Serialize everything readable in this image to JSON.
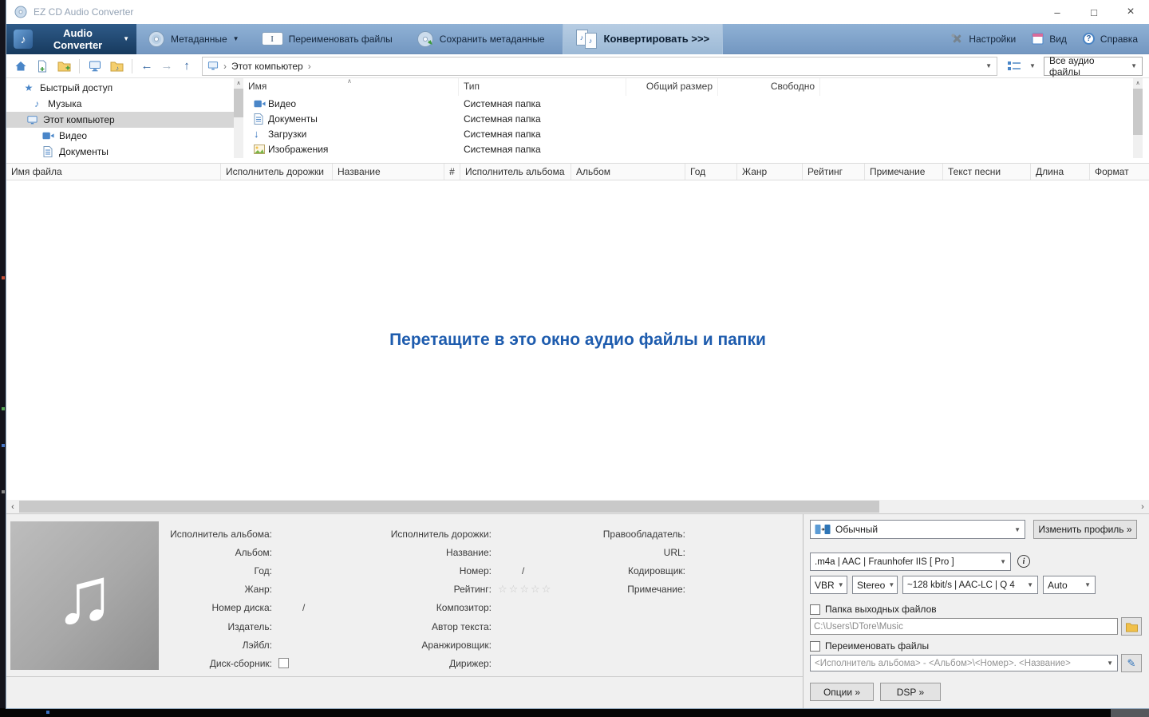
{
  "window": {
    "title": "EZ CD Audio Converter"
  },
  "icons": {
    "minimize": "–",
    "maximize": "□",
    "close": "×",
    "dropdown": "▼",
    "back": "←",
    "forward": "→",
    "up": "↑",
    "breadcrumb_sep": "›",
    "sort_asc": "∧",
    "scroll_up": "∧",
    "scroll_down": "∨",
    "scroll_left": "‹",
    "scroll_right": "›",
    "star_filled": "★",
    "star_empty": "☆",
    "note": "♫",
    "note_single": "♪",
    "download_arrow": "↓",
    "info": "i",
    "pencil": "✎",
    "text_cursor": "I",
    "question": "?"
  },
  "toolbar": {
    "audio_converter": "Audio Converter",
    "metadata": "Метаданные",
    "rename_files": "Переименовать файлы",
    "save_metadata": "Сохранить метаданные",
    "convert": "Конвертировать >>>",
    "settings": "Настройки",
    "view": "Вид",
    "help": "Справка"
  },
  "navbar": {
    "breadcrumb_root": "Этот компьютер",
    "filter": "Все аудио файлы"
  },
  "tree": {
    "items": [
      {
        "label": "Быстрый доступ"
      },
      {
        "label": "Музыка"
      },
      {
        "label": "Этот компьютер"
      },
      {
        "label": "Видео"
      },
      {
        "label": "Документы"
      }
    ]
  },
  "folders": {
    "columns": [
      "Имя",
      "Тип",
      "Общий размер",
      "Свободно"
    ],
    "rows": [
      {
        "name": "Видео",
        "type": "Системная папка"
      },
      {
        "name": "Документы",
        "type": "Системная папка"
      },
      {
        "name": "Загрузки",
        "type": "Системная папка"
      },
      {
        "name": "Изображения",
        "type": "Системная папка"
      }
    ]
  },
  "tracklist": {
    "columns": [
      "Имя файла",
      "Исполнитель дорожки",
      "Название",
      "#",
      "Исполнитель альбома",
      "Альбом",
      "Год",
      "Жанр",
      "Рейтинг",
      "Примечание",
      "Текст песни",
      "Длина",
      "Формат"
    ]
  },
  "dropzone": {
    "message": "Перетащите в это окно аудио файлы и папки"
  },
  "metadata": {
    "col1": [
      {
        "label": "Исполнитель альбома:",
        "value": ""
      },
      {
        "label": "Альбом:",
        "value": ""
      },
      {
        "label": "Год:",
        "value": ""
      },
      {
        "label": "Жанр:",
        "value": ""
      },
      {
        "label": "Номер диска:",
        "value": "/"
      },
      {
        "label": "Издатель:",
        "value": ""
      },
      {
        "label": "Лэйбл:",
        "value": ""
      },
      {
        "label": "Диск-сборник:",
        "value": ""
      }
    ],
    "col2": [
      {
        "label": "Исполнитель дорожки:",
        "value": ""
      },
      {
        "label": "Название:",
        "value": ""
      },
      {
        "label": "Номер:",
        "value": "/"
      },
      {
        "label": "Рейтинг:",
        "value": ""
      },
      {
        "label": "Композитор:",
        "value": ""
      },
      {
        "label": "Автор текста:",
        "value": ""
      },
      {
        "label": "Аранжировщик:",
        "value": ""
      },
      {
        "label": "Дирижер:",
        "value": ""
      }
    ],
    "col3": [
      {
        "label": "Правообладатель:",
        "value": ""
      },
      {
        "label": "URL:",
        "value": ""
      },
      {
        "label": "Кодировщик:",
        "value": ""
      },
      {
        "label": "Примечание:",
        "value": ""
      }
    ]
  },
  "output": {
    "profile": "Обычный",
    "edit_profile": "Изменить профиль »",
    "format": ".m4a  |  AAC  |  Fraunhofer IIS [ Pro ]",
    "bitrate_mode": "VBR",
    "channels": "Stereo",
    "bitrate": "~128 kbit/s | AAC-LC | Q 4",
    "sample_rate": "Auto",
    "output_folder_label": "Папка выходных файлов",
    "output_folder_path": "C:\\Users\\DTore\\Music",
    "rename_files_label": "Переименовать файлы",
    "rename_pattern": "<Исполнитель альбома> - <Альбом>\\<Номер>. <Название>",
    "options_button": "Опции »",
    "dsp_button": "DSP »"
  }
}
